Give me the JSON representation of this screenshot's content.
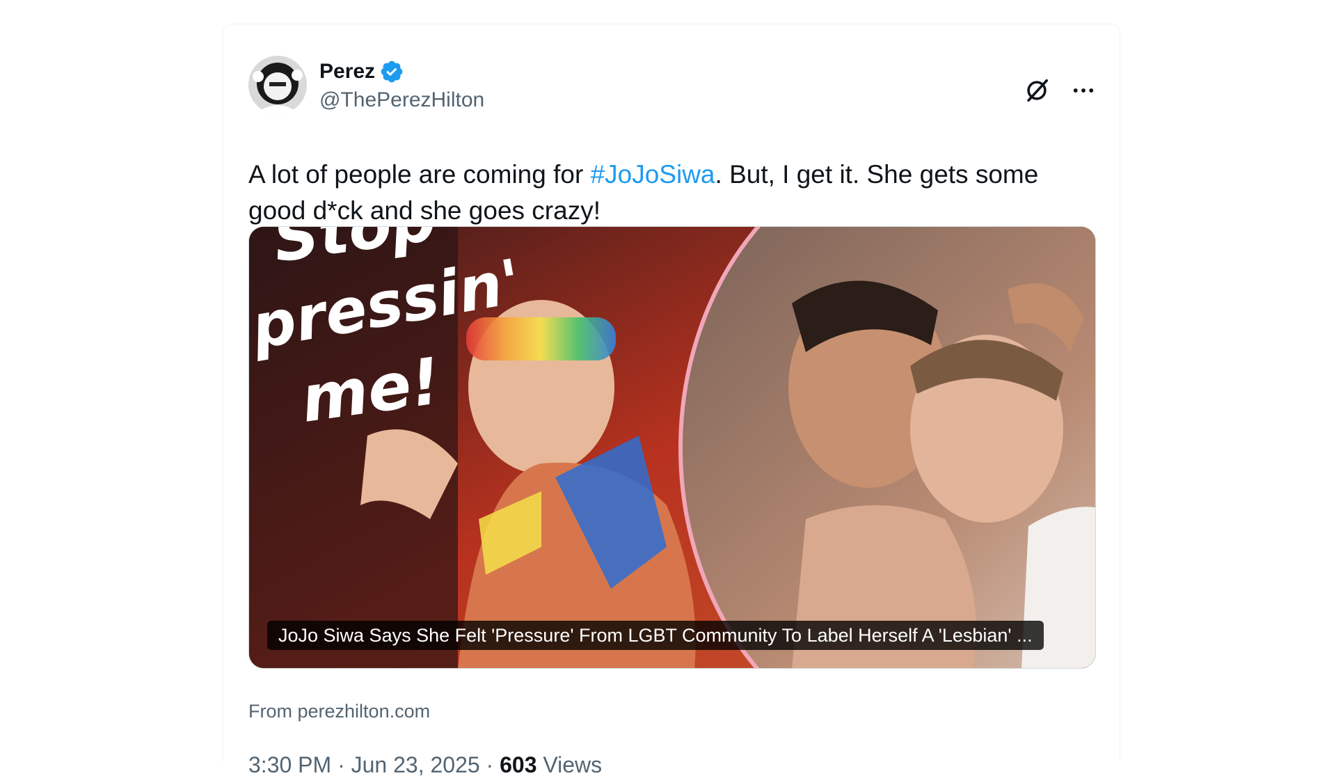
{
  "author": {
    "display_name": "Perez",
    "handle": "@ThePerezHilton",
    "verified": true,
    "avatar_icon": "avatar-photo"
  },
  "actions": {
    "grok_icon": "grok-icon",
    "more_icon": "more-dots-icon"
  },
  "tweet": {
    "text_before": "A lot of people are coming for ",
    "hashtag": "#JoJoSiwa",
    "text_after": ". But, I get it. She gets some good d*ck and she goes crazy!"
  },
  "media": {
    "overlay_text_line1": "Stop",
    "overlay_text_line2": "pressin'",
    "overlay_text_line3": "me!",
    "caption": "JoJo Siwa Says She Felt 'Pressure' From LGBT Community To Label Herself A 'Lesbian' ..."
  },
  "source": "From perezhilton.com",
  "meta": {
    "time": "3:30 PM",
    "separator": " · ",
    "date": "Jun 23, 2025",
    "views_count": "603",
    "views_label": " Views"
  },
  "colors": {
    "link": "#1d9bf0",
    "secondary_text": "#536471",
    "primary_text": "#0f1419",
    "verified_badge": "#1d9bf0",
    "media_border": "#cfd9de"
  }
}
